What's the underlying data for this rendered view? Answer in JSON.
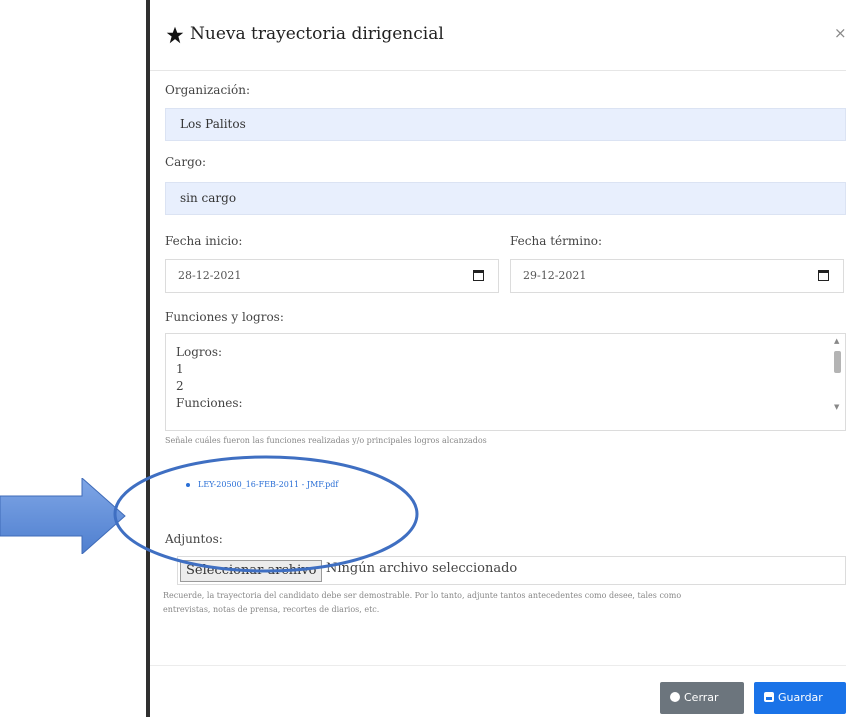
{
  "modal": {
    "title": "Nueva trayectoria dirigencial",
    "close_symbol": "×"
  },
  "form": {
    "organizacion": {
      "label": "Organización:",
      "value": "Los Palitos"
    },
    "cargo": {
      "label": "Cargo:",
      "value": "sin cargo"
    },
    "fecha_inicio": {
      "label": "Fecha inicio:",
      "value": "28-12-2021"
    },
    "fecha_termino": {
      "label": "Fecha término:",
      "value": "29-12-2021"
    },
    "funciones": {
      "label": "Funciones y logros:",
      "lines": [
        "Logros:",
        "1",
        "2",
        "Funciones:"
      ],
      "help": "Señale cuáles fueron las funciones realizadas y/o principales logros alcanzados"
    },
    "attachment_link": "LEY-20500_16-FEB-2011 - JMF.pdf",
    "adjuntos": {
      "label": "Adjuntos:",
      "button": "Seleccionar archivo",
      "status": "Ningún archivo seleccionado",
      "help_line1": "Recuerde, la trayectoria del candidato debe ser demostrable. Por lo tanto, adjunte tantos antecedentes como desee, tales como",
      "help_line2": "entrevistas, notas de prensa, recortes de diarios, etc."
    }
  },
  "footer": {
    "close_label": "Cerrar",
    "save_label": "Guardar"
  },
  "colors": {
    "primary": "#1a73e8",
    "secondary": "#6c757d",
    "input_fill": "#e8effd",
    "annotation_arrow": "#5b8ad6",
    "annotation_ellipse": "#3f6fc2"
  },
  "icons": [
    "star-icon",
    "close-icon",
    "calendar-icon",
    "times-circle-icon",
    "save-icon",
    "arrow-annotation",
    "ellipse-annotation"
  ]
}
